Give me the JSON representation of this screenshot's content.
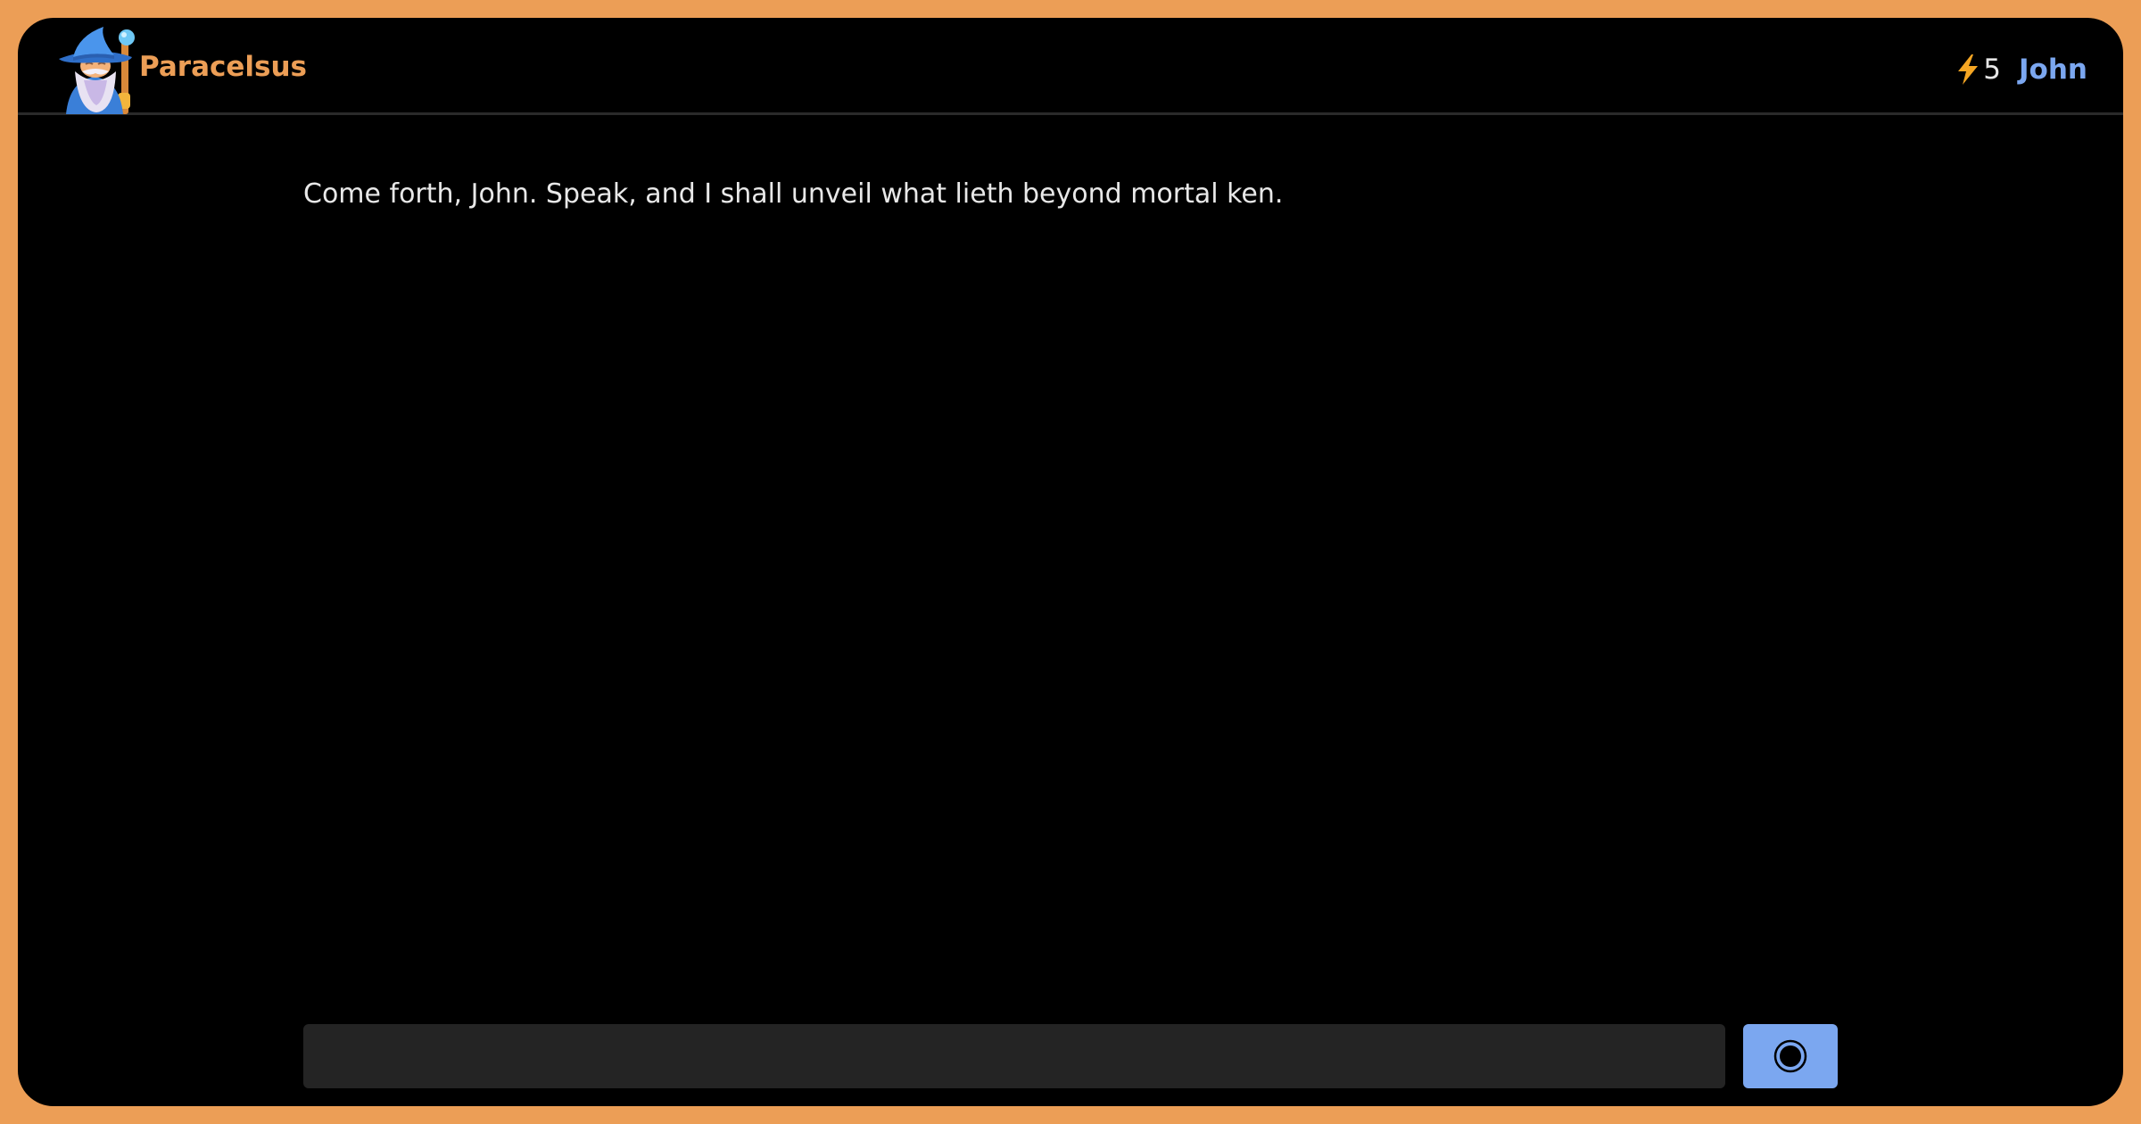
{
  "header": {
    "brand_name": "Paracelsus",
    "logo_icon": "wizard-icon",
    "credit_icon": "lightning-bolt-icon",
    "credits": "5",
    "user_name": "John"
  },
  "chat": {
    "messages": [
      {
        "role": "assistant",
        "text": "Come forth, John. Speak, and I shall unveil what lieth beyond mortal ken."
      }
    ]
  },
  "composer": {
    "input_value": "",
    "placeholder": "",
    "send_icon": "record-circle-icon"
  },
  "colors": {
    "page_background": "#EC9E56",
    "app_background": "#000000",
    "brand": "#EC9E56",
    "accent": "#7BA7F0",
    "bolt": "#F5A623",
    "input_background": "#242424",
    "message_text": "#E8E8E8",
    "divider": "#2A2A2A"
  }
}
